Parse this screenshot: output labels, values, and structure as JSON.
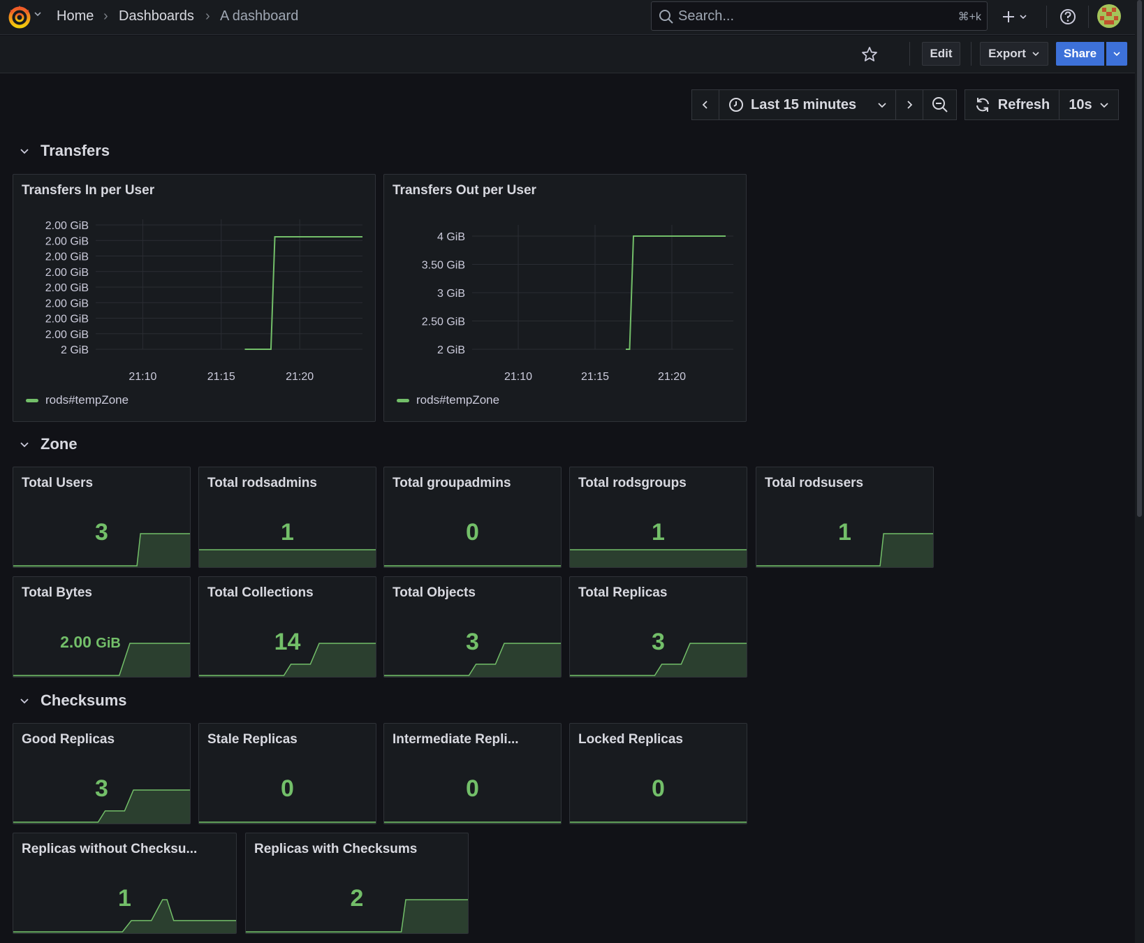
{
  "topbar": {
    "breadcrumbs": [
      "Home",
      "Dashboards",
      "A dashboard"
    ],
    "search": {
      "placeholder": "Search...",
      "shortcut": "⌘+k"
    }
  },
  "toolbar": {
    "edit": "Edit",
    "export": "Export",
    "share": "Share"
  },
  "timepicker": {
    "range": "Last 15 minutes",
    "refresh": "Refresh",
    "interval": "10s"
  },
  "rows": {
    "transfers": "Transfers",
    "zone": "Zone",
    "checksums": "Checksums"
  },
  "colors": {
    "accent": "#73bf69",
    "primary": "#3d71d9",
    "background": "#111217",
    "panel": "#181b1f"
  },
  "panels": {
    "transfers_in": {
      "title": "Transfers In per User",
      "legend": "rods#tempZone"
    },
    "transfers_out": {
      "title": "Transfers Out per User",
      "legend": "rods#tempZone"
    },
    "total_users": {
      "title": "Total Users",
      "value": "3"
    },
    "total_rodsadmins": {
      "title": "Total rodsadmins",
      "value": "1"
    },
    "total_groupadmins": {
      "title": "Total groupadmins",
      "value": "0"
    },
    "total_rodsgroups": {
      "title": "Total rodsgroups",
      "value": "1"
    },
    "total_rodsusers": {
      "title": "Total rodsusers",
      "value": "1"
    },
    "total_bytes": {
      "title": "Total Bytes",
      "value": "2.00",
      "unit": "GiB"
    },
    "total_collections": {
      "title": "Total Collections",
      "value": "14"
    },
    "total_objects": {
      "title": "Total Objects",
      "value": "3"
    },
    "total_replicas": {
      "title": "Total Replicas",
      "value": "3"
    },
    "good_replicas": {
      "title": "Good Replicas",
      "value": "3"
    },
    "stale_replicas": {
      "title": "Stale Replicas",
      "value": "0"
    },
    "intermediate_replicas": {
      "title": "Intermediate Repli...",
      "value": "0"
    },
    "locked_replicas": {
      "title": "Locked Replicas",
      "value": "0"
    },
    "replicas_without_checksums": {
      "title": "Replicas without Checksu...",
      "value": "1"
    },
    "replicas_with_checksums": {
      "title": "Replicas with Checksums",
      "value": "2"
    }
  },
  "chart_data": [
    {
      "type": "line",
      "title": "Transfers In per User",
      "x_ticks": [
        "21:10",
        "21:15",
        "21:20"
      ],
      "y_ticks": [
        "2 GiB",
        "2.00 GiB",
        "2.00 GiB",
        "2.00 GiB",
        "2.00 GiB",
        "2.00 GiB",
        "2.00 GiB",
        "2.00 GiB",
        "2.00 GiB"
      ],
      "series": [
        {
          "name": "rods#tempZone",
          "x": [
            "21:16:30",
            "21:18:10",
            "21:18:25",
            "21:24:00"
          ],
          "y": [
            2.0,
            2.0,
            2.00001,
            2.00001
          ]
        }
      ]
    },
    {
      "type": "line",
      "title": "Transfers Out per User",
      "x_ticks": [
        "21:10",
        "21:15",
        "21:20"
      ],
      "y_ticks": [
        "2 GiB",
        "2.50 GiB",
        "3 GiB",
        "3.50 GiB",
        "4 GiB"
      ],
      "ylim": [
        2,
        4
      ],
      "series": [
        {
          "name": "rods#tempZone",
          "x": [
            "21:17:00",
            "21:17:15",
            "21:17:30",
            "21:23:30"
          ],
          "y": [
            2.0,
            2.0,
            4.0,
            4.0
          ]
        }
      ]
    }
  ]
}
